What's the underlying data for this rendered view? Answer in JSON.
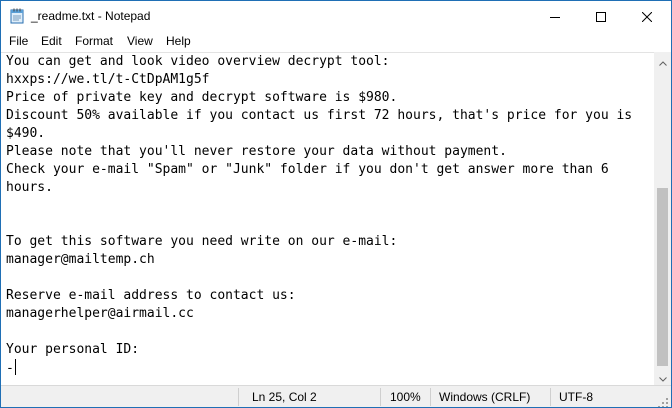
{
  "window": {
    "title": "_readme.txt - Notepad",
    "accent_color": "#1f6fb5",
    "icons": [
      "notepad-icon",
      "minimize-icon",
      "maximize-icon",
      "close-icon"
    ]
  },
  "menu": {
    "items": [
      "File",
      "Edit",
      "Format",
      "View",
      "Help"
    ]
  },
  "editor": {
    "lines": [
      "You can get and look video overview decrypt tool:",
      "hxxps://we.tl/t-CtDpAM1g5f",
      "Price of private key and decrypt software is $980.",
      "Discount 50% available if you contact us first 72 hours, that's price for you is",
      "$490.",
      "Please note that you'll never restore your data without payment.",
      "Check your e-mail \"Spam\" or \"Junk\" folder if you don't get answer more than 6",
      "hours.",
      "",
      "",
      "To get this software you need write on our e-mail:",
      "manager@mailtemp.ch",
      "",
      "Reserve e-mail address to contact us:",
      "managerhelper@airmail.cc",
      "",
      "Your personal ID:",
      "-"
    ]
  },
  "statusbar": {
    "position": "Ln 25, Col 2",
    "zoom": "100%",
    "line_ending": "Windows (CRLF)",
    "encoding": "UTF-8"
  }
}
